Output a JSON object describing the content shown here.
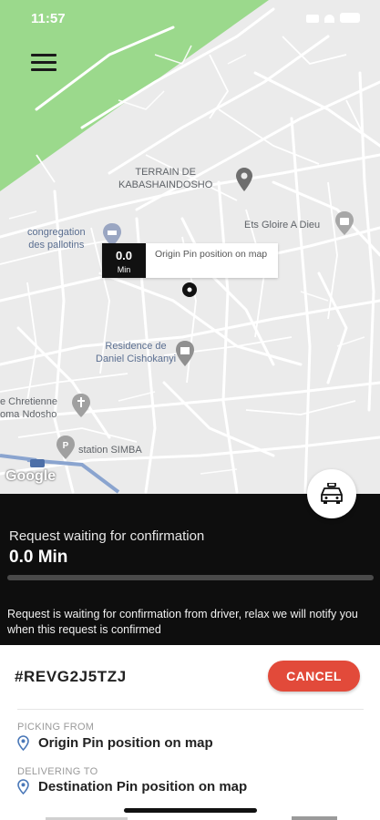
{
  "status_bar": {
    "time": "11:57"
  },
  "map": {
    "labels": {
      "terrain": "TERRAIN DE\nKABASHAINDOSHO",
      "ets": "Ets Gloire A Dieu",
      "congregation": "congregation\ndes pallotins",
      "residence": "Residence de\nDaniel Cishokanyi",
      "chretienne": "e Chretienne\noma Ndosho",
      "station": "station SIMBA"
    },
    "pin": {
      "time_value": "0.0",
      "time_unit": "Min",
      "label": "Origin Pin position on map"
    },
    "google": "Google"
  },
  "panel": {
    "title": "Request waiting for confirmation",
    "time": "0.0 Min",
    "progress": 0,
    "message": "Request is waiting for confirmation from driver, relax we will notify you when this request is confirmed"
  },
  "request": {
    "id": "#REVG2J5TZJ",
    "cancel_label": "CANCEL",
    "picking_label": "PICKING FROM",
    "picking_value": "Origin Pin position on map",
    "delivering_label": "DELIVERING TO",
    "delivering_value": "Destination Pin position on map"
  },
  "colors": {
    "accent": "#e24a3a",
    "map_green": "#99d98a",
    "panel_bg": "#0e0e0e"
  },
  "icons": [
    "menu-icon",
    "taxi-icon",
    "location-pin-icon",
    "map-marker-icon",
    "hotel-icon",
    "church-icon",
    "shopping-icon",
    "parking-icon"
  ]
}
